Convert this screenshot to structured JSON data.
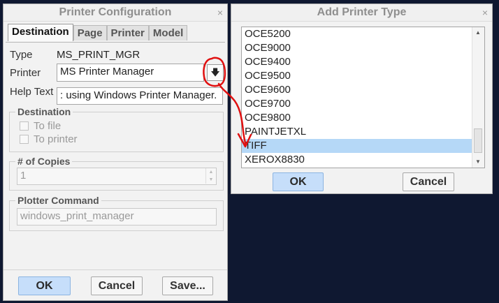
{
  "printer_config": {
    "title": "Printer Configuration",
    "close": "×",
    "tabs": [
      "Destination",
      "Page",
      "Printer",
      "Model"
    ],
    "type_label": "Type",
    "type_value": "MS_PRINT_MGR",
    "printer_label": "Printer",
    "printer_value": "MS Printer Manager",
    "help_label": "Help Text",
    "help_value": ": using Windows Printer Manager.",
    "destination_group": "Destination",
    "to_file": "To file",
    "to_printer": "To printer",
    "copies_group": "# of Copies",
    "copies_value": "1",
    "plotter_group": "Plotter Command",
    "plotter_value": "windows_print_manager",
    "ok": "OK",
    "cancel": "Cancel",
    "save": "Save..."
  },
  "add_printer": {
    "title": "Add Printer Type",
    "close": "×",
    "items": [
      "OCE5200",
      "OCE9000",
      "OCE9400",
      "OCE9500",
      "OCE9600",
      "OCE9700",
      "OCE9800",
      "PAINTJETXL",
      "TIFF",
      "XEROX8830"
    ],
    "selected": "TIFF",
    "ok": "OK",
    "cancel": "Cancel"
  },
  "colors": {
    "background": "#0f1831",
    "selection": "#b5d8f7",
    "primary_button": "#c6defa",
    "annotation": "#e01010"
  },
  "icons": {
    "printer_browse": "down-arrow-icon",
    "scroll_up": "chevron-up-icon",
    "scroll_down": "chevron-down-icon"
  }
}
